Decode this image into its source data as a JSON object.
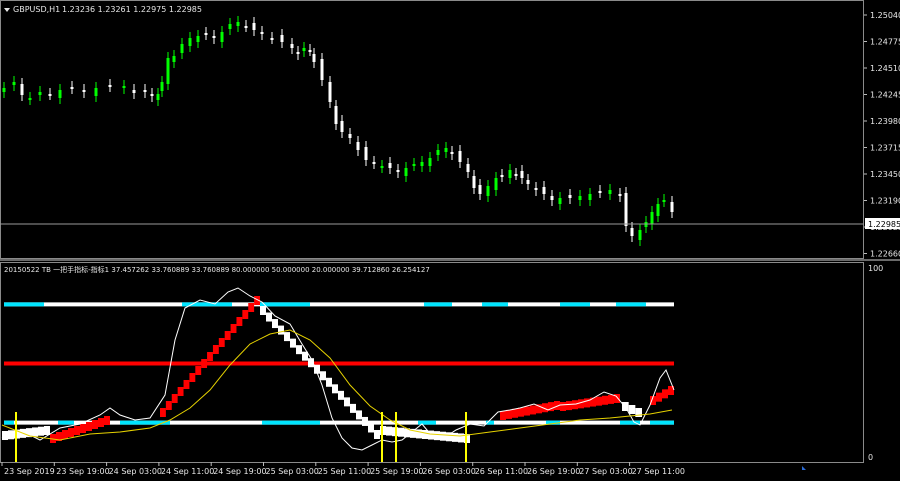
{
  "main_chart": {
    "symbol_label": "GBPUSD,H1",
    "ohlc_label": "1.23236 1.23261 1.22975 1.22985",
    "price_ticks": [
      "1.25040",
      "1.24775",
      "1.24510",
      "1.24245",
      "1.23980",
      "1.23715",
      "1.23450",
      "1.23190",
      "1.22925",
      "1.22660"
    ],
    "current_price": "1.22985",
    "colors": {
      "bull": "#00ff00",
      "bear": "#ffffff",
      "background": "#000000"
    }
  },
  "indicator": {
    "label": "20150522 TB 一把手指标-指标1 37.457262 33.760889 33.760889 80.000000 50.000000 20.000000 39.712860 26.254127",
    "axis_top": "100",
    "axis_bottom": "0",
    "levels": [
      80,
      50,
      20
    ],
    "colors": {
      "upper_line": "#ffffff",
      "mid_line": "#ff0000",
      "lower_line": "#ffffff",
      "accent": "#00e5ff",
      "signal": "#ffff00",
      "bars_up": "#ff0000",
      "bars_down": "#ffffff"
    }
  },
  "time_axis": [
    "23 Sep 2019",
    "23 Sep 19:00",
    "24 Sep 03:00",
    "24 Sep 11:00",
    "24 Sep 19:00",
    "25 Sep 03:00",
    "25 Sep 11:00",
    "25 Sep 19:00",
    "26 Sep 03:00",
    "26 Sep 11:00",
    "26 Sep 19:00",
    "27 Sep 03:00",
    "27 Sep 11:00"
  ]
}
